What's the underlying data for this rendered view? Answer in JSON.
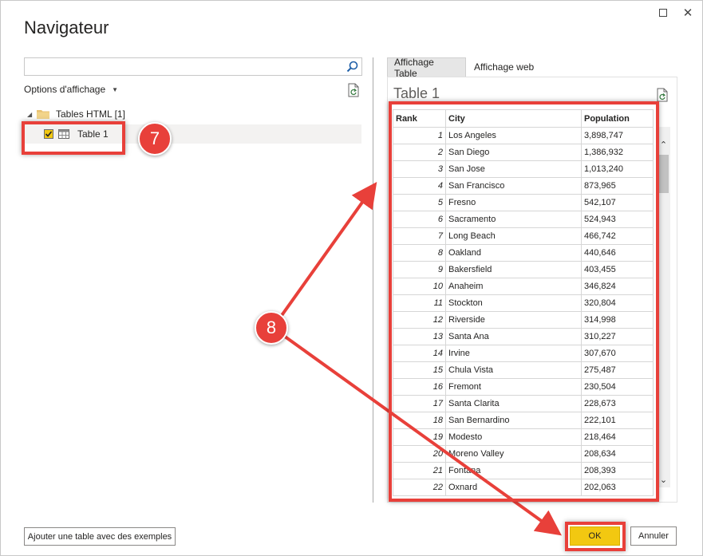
{
  "window": {
    "title": "Navigateur",
    "close_glyph": "✕",
    "icons": {
      "maximize": "maximize-icon",
      "close": "close-icon"
    }
  },
  "left": {
    "search": {
      "value": "",
      "placeholder": "",
      "icon": "search-icon"
    },
    "view_options_label": "Options d'affichage",
    "tree": {
      "folder_label": "Tables HTML [1]",
      "items": [
        {
          "label": "Table 1",
          "checked": true
        }
      ]
    },
    "add_table_label": "Ajouter une table avec des exemples"
  },
  "right": {
    "tabs": [
      {
        "label": "Affichage Table",
        "active": true
      },
      {
        "label": "Affichage web",
        "active": false
      }
    ],
    "preview_title": "Table 1",
    "columns": [
      "Rank",
      "City",
      "Population"
    ],
    "rows": [
      [
        "1",
        "Los Angeles",
        "3,898,747"
      ],
      [
        "2",
        "San Diego",
        "1,386,932"
      ],
      [
        "3",
        "San Jose",
        "1,013,240"
      ],
      [
        "4",
        "San Francisco",
        "873,965"
      ],
      [
        "5",
        "Fresno",
        "542,107"
      ],
      [
        "6",
        "Sacramento",
        "524,943"
      ],
      [
        "7",
        "Long Beach",
        "466,742"
      ],
      [
        "8",
        "Oakland",
        "440,646"
      ],
      [
        "9",
        "Bakersfield",
        "403,455"
      ],
      [
        "10",
        "Anaheim",
        "346,824"
      ],
      [
        "11",
        "Stockton",
        "320,804"
      ],
      [
        "12",
        "Riverside",
        "314,998"
      ],
      [
        "13",
        "Santa Ana",
        "310,227"
      ],
      [
        "14",
        "Irvine",
        "307,670"
      ],
      [
        "15",
        "Chula Vista",
        "275,487"
      ],
      [
        "16",
        "Fremont",
        "230,504"
      ],
      [
        "17",
        "Santa Clarita",
        "228,673"
      ],
      [
        "18",
        "San Bernardino",
        "222,101"
      ],
      [
        "19",
        "Modesto",
        "218,464"
      ],
      [
        "20",
        "Moreno Valley",
        "208,634"
      ],
      [
        "21",
        "Fontana",
        "208,393"
      ],
      [
        "22",
        "Oxnard",
        "202,063"
      ]
    ]
  },
  "footer": {
    "ok_label": "OK",
    "cancel_label": "Annuler"
  },
  "annotations": {
    "step_7": "7",
    "step_8": "8",
    "color": "#e8403a"
  },
  "colors": {
    "accent": "#f2c811",
    "highlight": "#e8403a"
  }
}
